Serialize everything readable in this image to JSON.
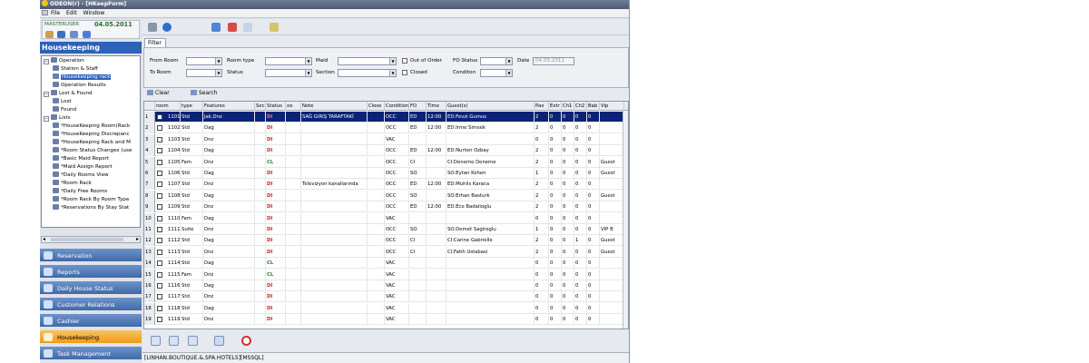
{
  "window": {
    "title": "ODEON(r) - [HKeepForm]"
  },
  "menu": {
    "items": [
      "File",
      "Edit",
      "Window"
    ]
  },
  "user": {
    "name": "MASTERUSER",
    "date": "04.05.2011"
  },
  "module_title": "Housekeeping",
  "tree": [
    {
      "label": "Operation",
      "level": 0,
      "expander": "−"
    },
    {
      "label": "Station & Staff",
      "level": 1
    },
    {
      "label": "Housekeeping rack",
      "level": 1,
      "selected": true
    },
    {
      "label": "Operation Results",
      "level": 1
    },
    {
      "label": "Lost & Found",
      "level": 0,
      "expander": "−"
    },
    {
      "label": "Lost",
      "level": 1
    },
    {
      "label": "Found",
      "level": 1
    },
    {
      "label": "Lists",
      "level": 0,
      "expander": "−"
    },
    {
      "label": "*HouseKeeping Room(Rack",
      "level": 1
    },
    {
      "label": "*HouseKeeping Discrepanc",
      "level": 1
    },
    {
      "label": "*HouseKeeping Rack and M",
      "level": 1
    },
    {
      "label": "*Room Status Changes (use",
      "level": 1
    },
    {
      "label": "*Basic Maid Report",
      "level": 1
    },
    {
      "label": "*Maid Assign Report",
      "level": 1
    },
    {
      "label": "*Daily Rooms View",
      "level": 1
    },
    {
      "label": "*Room Rack",
      "level": 1
    },
    {
      "label": "*Daily Free Rooms",
      "level": 1
    },
    {
      "label": "*Room Rack By Room Type",
      "level": 1
    },
    {
      "label": "*Reservations By Stay Stat",
      "level": 1
    }
  ],
  "nav": [
    {
      "label": "Reservation",
      "active": false
    },
    {
      "label": "Reports",
      "active": false
    },
    {
      "label": "Daily House Status",
      "active": false
    },
    {
      "label": "Customer Relations",
      "active": false
    },
    {
      "label": "Cashier",
      "active": false
    },
    {
      "label": "Housekeeping",
      "active": true
    },
    {
      "label": "Task Management",
      "active": false
    }
  ],
  "filter": {
    "tab_label": "Filter",
    "from_room": "From Room",
    "to_room": "To Room",
    "room_type": "Room type",
    "status": "Status",
    "maid": "Maid",
    "section": "Section",
    "out_of_order": "Out of Order",
    "closed": "Closed",
    "fo_status": "FO Status",
    "condition": "Conditon",
    "date_label": "Date",
    "date_value": "04.05.2011"
  },
  "actions": {
    "clear": "Clear",
    "search": "Search"
  },
  "grid": {
    "columns": [
      "",
      "room",
      "type",
      "Features",
      "Sec",
      "Status",
      "oo",
      "Note",
      "Close",
      "Condition",
      "FO",
      "Time",
      "Guest(s)",
      "Pax",
      "Extr",
      "Ch1",
      "Ch2",
      "Bab",
      "Vip"
    ],
    "rows": [
      [
        "1",
        "1101",
        "Std",
        "Jak,Dnz",
        "",
        "DI",
        "",
        "SAĞ GIRIŞ TARAFTAKİ",
        "",
        "OCC",
        "ED",
        "12:00",
        "ED:Fevzi Gumus",
        "2",
        "0",
        "0",
        "0",
        "0",
        ""
      ],
      [
        "2",
        "1102",
        "Std",
        "Dag",
        "",
        "DI",
        "",
        "",
        "",
        "OCC",
        "ED",
        "12:00",
        "ED:Irme Simsek",
        "2",
        "0",
        "0",
        "0",
        "0",
        ""
      ],
      [
        "3",
        "1103",
        "Std",
        "Dnz",
        "",
        "DI",
        "",
        "",
        "",
        "VAC",
        "",
        "",
        "",
        "0",
        "0",
        "0",
        "0",
        "0",
        ""
      ],
      [
        "4",
        "1104",
        "Std",
        "Dag",
        "",
        "DI",
        "",
        "",
        "",
        "OCC",
        "ED",
        "12:00",
        "ED:Nurten Ozbay",
        "2",
        "0",
        "0",
        "0",
        "0",
        ""
      ],
      [
        "5",
        "1105",
        "Fam",
        "Dnz",
        "",
        "CL",
        "",
        "",
        "",
        "OCC",
        "CI",
        "",
        "CI:Deneme Deneme",
        "2",
        "0",
        "0",
        "0",
        "0",
        "Guest"
      ],
      [
        "6",
        "1106",
        "Std",
        "Dag",
        "",
        "DI",
        "",
        "",
        "",
        "OCC",
        "SO",
        "",
        "SO:Eytan Kohen",
        "1",
        "0",
        "0",
        "0",
        "0",
        "Guest"
      ],
      [
        "7",
        "1107",
        "Std",
        "Dnz",
        "",
        "DI",
        "",
        "Televizyon kanallarında",
        "",
        "OCC",
        "ED",
        "12:00",
        "ED:Muhlis Karaca",
        "2",
        "0",
        "0",
        "0",
        "0",
        ""
      ],
      [
        "8",
        "1108",
        "Std",
        "Dag",
        "",
        "DI",
        "",
        "",
        "",
        "OCC",
        "SO",
        "",
        "SO:Erhan Basturk",
        "2",
        "0",
        "0",
        "0",
        "0",
        "Guest"
      ],
      [
        "9",
        "1109",
        "Std",
        "Dnz",
        "",
        "DI",
        "",
        "",
        "",
        "OCC",
        "ED",
        "12:00",
        "ED:Ece Badalioglu",
        "2",
        "0",
        "0",
        "0",
        "0",
        ""
      ],
      [
        "10",
        "1110",
        "Fam",
        "Dag",
        "",
        "DI",
        "",
        "",
        "",
        "VAC",
        "",
        "",
        "",
        "0",
        "0",
        "0",
        "0",
        "0",
        ""
      ],
      [
        "11",
        "1111",
        "Suite",
        "Dnz",
        "",
        "DI",
        "",
        "",
        "",
        "OCC",
        "SO",
        "",
        "SO:Demet Sagiroglu",
        "1",
        "0",
        "0",
        "0",
        "0",
        "VIP B"
      ],
      [
        "12",
        "1112",
        "Std",
        "Dag",
        "",
        "DI",
        "",
        "",
        "",
        "OCC",
        "CI",
        "",
        "CI:Carine Gabrielle",
        "2",
        "0",
        "0",
        "1",
        "0",
        "Guest"
      ],
      [
        "13",
        "1113",
        "Std",
        "Dnz",
        "",
        "DI",
        "",
        "",
        "",
        "OCC",
        "CI",
        "",
        "CI:Fatih Ustabasi",
        "2",
        "0",
        "0",
        "0",
        "0",
        "Guest"
      ],
      [
        "14",
        "1114",
        "Std",
        "Dag",
        "",
        "CL",
        "",
        "",
        "",
        "VAC",
        "",
        "",
        "",
        "0",
        "0",
        "0",
        "0",
        "0",
        ""
      ],
      [
        "15",
        "1115",
        "Fam",
        "Dnz",
        "",
        "CL",
        "",
        "",
        "",
        "VAC",
        "",
        "",
        "",
        "0",
        "0",
        "0",
        "0",
        "0",
        ""
      ],
      [
        "16",
        "1116",
        "Std",
        "Dag",
        "",
        "DI",
        "",
        "",
        "",
        "VAC",
        "",
        "",
        "",
        "0",
        "0",
        "0",
        "0",
        "0",
        ""
      ],
      [
        "17",
        "1117",
        "Std",
        "Dnz",
        "",
        "DI",
        "",
        "",
        "",
        "VAC",
        "",
        "",
        "",
        "0",
        "0",
        "0",
        "0",
        "0",
        ""
      ],
      [
        "18",
        "1118",
        "Std",
        "Dag",
        "",
        "DI",
        "",
        "",
        "",
        "VAC",
        "",
        "",
        "",
        "0",
        "0",
        "0",
        "0",
        "0",
        ""
      ],
      [
        "19",
        "1119",
        "Std",
        "Dnz",
        "",
        "DI",
        "",
        "",
        "",
        "VAC",
        "",
        "",
        "",
        "0",
        "0",
        "0",
        "0",
        "0",
        ""
      ]
    ]
  },
  "statusbar": {
    "text": "[LINHAN.BOUTIQUE.&.SPA.HOTELS][MSSQL]"
  },
  "colors": {
    "accent": "#2c63b6",
    "nav_active": "#f2a830",
    "selected_row": "#0b2377",
    "dirty": "#c62828",
    "clean": "#2e7d32"
  }
}
